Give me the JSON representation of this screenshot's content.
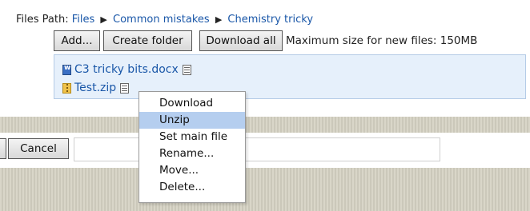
{
  "path": {
    "label": "Files Path:",
    "crumbs": [
      "Files",
      "Common mistakes",
      "Chemistry tricky"
    ],
    "separator": "▶"
  },
  "toolbar": {
    "add_label": "Add...",
    "create_folder_label": "Create folder",
    "download_all_label": "Download all",
    "max_size_text": "Maximum size for new files: 150MB"
  },
  "files": [
    {
      "name": "C3 tricky bits.docx",
      "icon": "word-document-icon"
    },
    {
      "name": "Test.zip",
      "icon": "zip-archive-icon"
    }
  ],
  "context_menu": {
    "items": [
      "Download",
      "Unzip",
      "Set main file",
      "Rename...",
      "Move...",
      "Delete..."
    ],
    "highlighted": "Unzip"
  },
  "form": {
    "cancel_label": "Cancel"
  },
  "colors": {
    "link": "#1a57a8",
    "file_area_bg": "#e6f0fb",
    "menu_highlight": "#b5ceef",
    "band": "#d6d3c4"
  }
}
